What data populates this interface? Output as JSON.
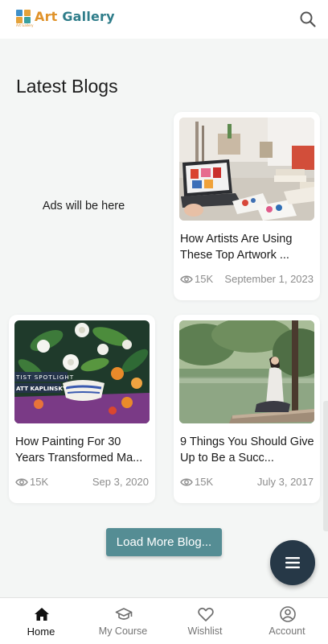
{
  "app": {
    "brand_part1": "Art",
    "brand_part2": "Gallery",
    "logo_small_text": "Art Gallery",
    "brand_color_orange": "#e0932b",
    "brand_color_teal": "#2f7d8a"
  },
  "topbar": {
    "search_icon": "search-icon"
  },
  "section": {
    "title": "Latest Blogs"
  },
  "ad": {
    "text": "Ads will be here"
  },
  "posts": [
    {
      "title_line1": "How Artists Are Using",
      "title_line2": "These Top Artwork ...",
      "views": "15K",
      "date": "September 1, 2023",
      "image": "artist-desk-photo"
    },
    {
      "title_line1": "How Painting For 30",
      "title_line2": "Years Transformed Ma...",
      "views": "15K",
      "date": "Sep 3, 2020",
      "image": "floral-painting-photo",
      "image_caption_line1": "TIST SPOTLIGHT",
      "image_caption_line2": "ATT KAPLINSKY"
    },
    {
      "title_line1": "9 Things You Should Give",
      "title_line2": "Up to Be a Succ...",
      "views": "15K",
      "date": "July 3, 2017",
      "image": "meditation-lake-photo"
    }
  ],
  "load_more": {
    "label": "Load More Blog..."
  },
  "fab": {
    "icon": "menu-icon",
    "color": "#263847"
  },
  "bottom_nav": {
    "items": [
      {
        "label": "Home",
        "icon": "home-icon",
        "active": true
      },
      {
        "label": "My Course",
        "icon": "graduation-cap-icon",
        "active": false
      },
      {
        "label": "Wishlist",
        "icon": "heart-icon",
        "active": false
      },
      {
        "label": "Account",
        "icon": "account-icon",
        "active": false
      }
    ]
  }
}
